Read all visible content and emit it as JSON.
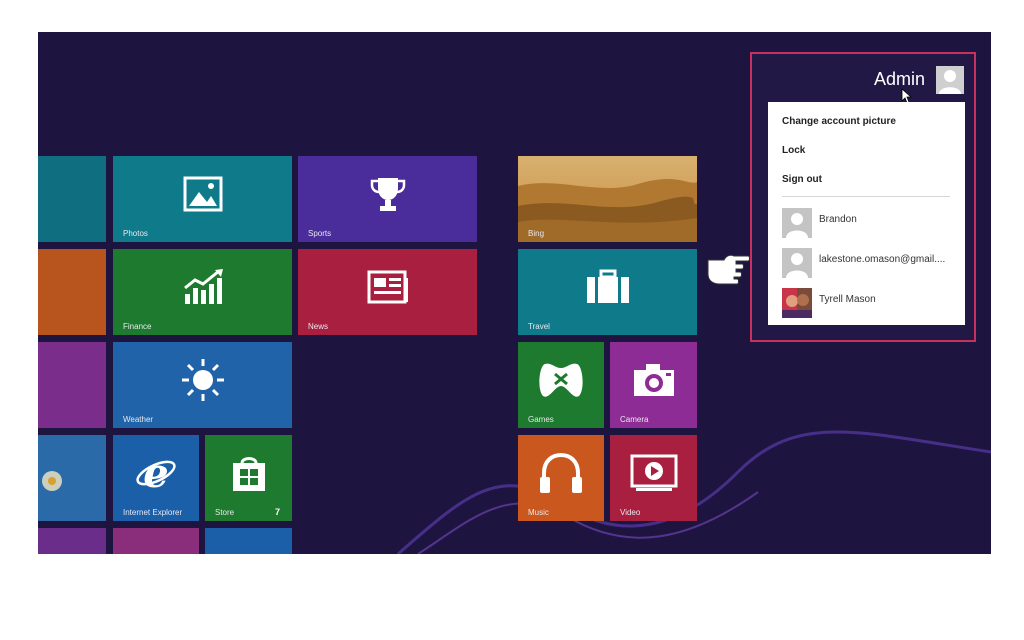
{
  "account": {
    "username": "Admin",
    "menu": {
      "change_picture": "Change account picture",
      "lock": "Lock",
      "sign_out": "Sign out"
    },
    "users": [
      {
        "name": "Brandon",
        "avatar": "default-user-icon"
      },
      {
        "name": "lakestone.omason@gmail....",
        "avatar": "default-user-icon"
      },
      {
        "name": "Tyrell Mason",
        "avatar": "photo-avatar"
      }
    ]
  },
  "tiles": {
    "photos": {
      "label": "Photos",
      "color": "#0f7a8a",
      "icon": "photo-icon"
    },
    "sports": {
      "label": "Sports",
      "color": "#4a2d9a",
      "icon": "trophy-icon"
    },
    "finance": {
      "label": "Finance",
      "color": "#1e7a2e",
      "icon": "chart-icon"
    },
    "news": {
      "label": "News",
      "color": "#a81f3f",
      "icon": "newspaper-icon"
    },
    "weather": {
      "label": "Weather",
      "color": "#2163a8",
      "icon": "sun-icon"
    },
    "internet_explorer": {
      "label": "Internet Explorer",
      "color": "#1a5fa8",
      "icon": "ie-icon"
    },
    "store": {
      "label": "Store",
      "color": "#1e7a2e",
      "icon": "store-icon",
      "badge": "7"
    },
    "bing": {
      "label": "Bing",
      "color": "#b8892a",
      "icon": "desert-image"
    },
    "travel": {
      "label": "Travel",
      "color": "#0f7a8a",
      "icon": "suitcase-icon"
    },
    "games": {
      "label": "Games",
      "color": "#1e7a2e",
      "icon": "xbox-controller-icon"
    },
    "camera": {
      "label": "Camera",
      "color": "#8e2c95",
      "icon": "camera-icon"
    },
    "music": {
      "label": "Music",
      "color": "#c9571e",
      "icon": "headphones-icon"
    },
    "video": {
      "label": "Video",
      "color": "#a81f3f",
      "icon": "play-icon"
    }
  },
  "colors": {
    "screen_bg": "#1d1540",
    "highlight_border": "#c8315f"
  }
}
